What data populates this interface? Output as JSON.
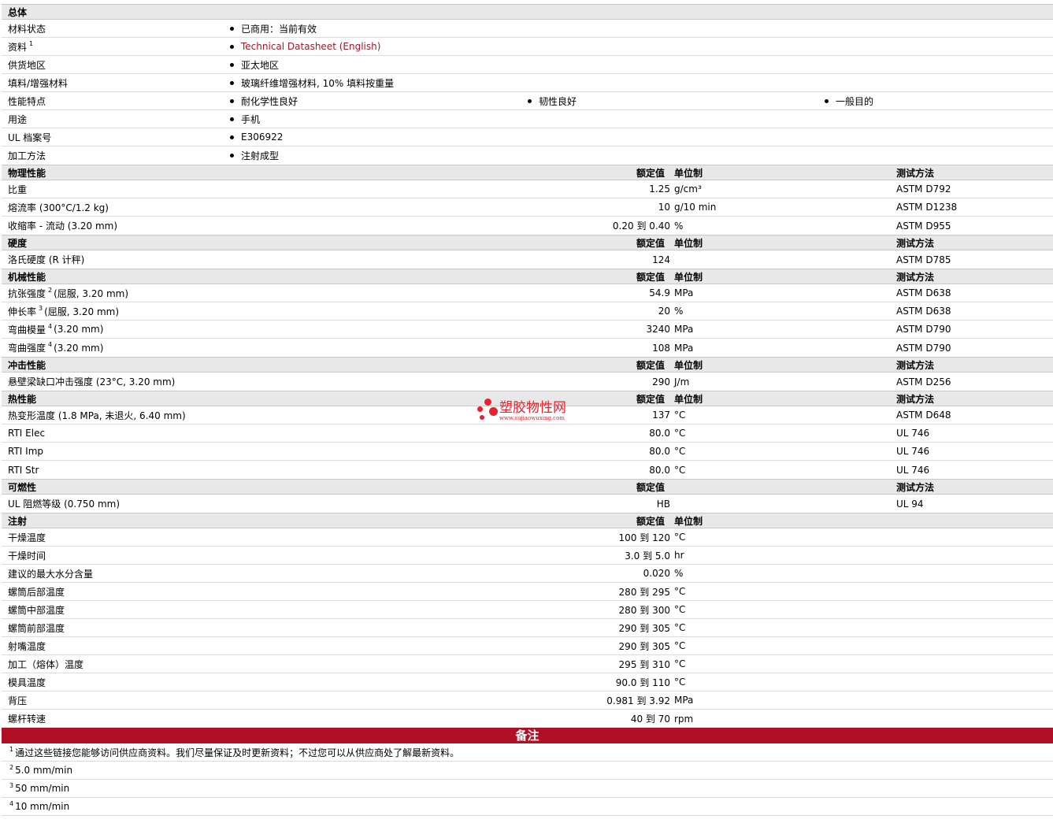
{
  "general": {
    "title": "总体",
    "material_status": {
      "label": "材料状态",
      "value": "已商用：当前有效"
    },
    "literature": {
      "label": "资料",
      "sup": "1",
      "value": "Technical Datasheet (English)"
    },
    "availability": {
      "label": "供货地区",
      "value": "亚太地区"
    },
    "filler": {
      "label": "填料/增强材料",
      "value": "玻璃纤维增强材料, 10% 填料按重量"
    },
    "features": {
      "label": "性能特点",
      "values": [
        "耐化学性良好",
        "韧性良好",
        "一般目的"
      ]
    },
    "uses": {
      "label": "用途",
      "value": "手机"
    },
    "ul_file": {
      "label": "UL 档案号",
      "value": "E306922"
    },
    "processing": {
      "label": "加工方法",
      "value": "注射成型"
    }
  },
  "headers": {
    "value": "额定值",
    "unit": "单位制",
    "method": "测试方法"
  },
  "physical": {
    "title": "物理性能",
    "rows": [
      {
        "label": "比重",
        "value": "1.25",
        "unit": "g/cm³",
        "method": "ASTM D792"
      },
      {
        "label": "熔流率  (300°C/1.2 kg)",
        "value": "10",
        "unit": "g/10 min",
        "method": "ASTM D1238"
      },
      {
        "label": "收缩率  - 流动  (3.20 mm)",
        "value": "0.20 到  0.40",
        "unit": "%",
        "method": "ASTM D955"
      }
    ]
  },
  "hardness": {
    "title": "硬度",
    "rows": [
      {
        "label": "洛氏硬度  (R 计秤)",
        "value": "124",
        "unit": "",
        "method": "ASTM D785"
      }
    ]
  },
  "mechanical": {
    "title": "机械性能",
    "rows": [
      {
        "label": "抗张强度",
        "sup": "2",
        "label2": "(屈服, 3.20 mm)",
        "value": "54.9",
        "unit": "MPa",
        "method": "ASTM D638"
      },
      {
        "label": "伸长率",
        "sup": "3",
        "label2": "(屈服, 3.20 mm)",
        "value": "20",
        "unit": "%",
        "method": "ASTM D638"
      },
      {
        "label": "弯曲模量",
        "sup": "4",
        "label2": "(3.20 mm)",
        "value": "3240",
        "unit": "MPa",
        "method": "ASTM D790"
      },
      {
        "label": "弯曲强度",
        "sup": "4",
        "label2": "(3.20 mm)",
        "value": "108",
        "unit": "MPa",
        "method": "ASTM D790"
      }
    ]
  },
  "impact": {
    "title": "冲击性能",
    "rows": [
      {
        "label": "悬壁梁缺口冲击强度  (23°C, 3.20 mm)",
        "value": "290",
        "unit": "J/m",
        "method": "ASTM D256"
      }
    ]
  },
  "thermal": {
    "title": "热性能",
    "rows": [
      {
        "label": "热变形温度  (1.8 MPa, 未退火, 6.40 mm)",
        "value": "137",
        "unit": "°C",
        "method": "ASTM D648"
      },
      {
        "label": "RTI Elec",
        "value": "80.0",
        "unit": "°C",
        "method": "UL 746"
      },
      {
        "label": "RTI Imp",
        "value": "80.0",
        "unit": "°C",
        "method": "UL 746"
      },
      {
        "label": "RTI Str",
        "value": "80.0",
        "unit": "°C",
        "method": "UL 746"
      }
    ]
  },
  "flammability": {
    "title": "可燃性",
    "rows": [
      {
        "label": "UL 阻燃等级  (0.750 mm)",
        "value": "HB",
        "unit": "",
        "method": "UL 94"
      }
    ]
  },
  "injection": {
    "title": "注射",
    "rows": [
      {
        "label": "干燥温度",
        "value": "100 到  120",
        "unit": "°C"
      },
      {
        "label": "干燥时间",
        "value": "3.0 到  5.0",
        "unit": "hr"
      },
      {
        "label": "建议的最大水分含量",
        "value": "0.020",
        "unit": "%"
      },
      {
        "label": "螺筒后部温度",
        "value": "280 到  295",
        "unit": "°C"
      },
      {
        "label": "螺筒中部温度",
        "value": "280 到  300",
        "unit": "°C"
      },
      {
        "label": "螺筒前部温度",
        "value": "290 到  305",
        "unit": "°C"
      },
      {
        "label": "射嘴温度",
        "value": "290 到  305",
        "unit": "°C"
      },
      {
        "label": "加工（熔体）温度",
        "value": "295 到  310",
        "unit": "°C"
      },
      {
        "label": "模具温度",
        "value": "90.0 到  110",
        "unit": "°C"
      },
      {
        "label": "背压",
        "value": "0.981 到  3.92",
        "unit": "MPa"
      },
      {
        "label": "螺杆转速",
        "value": "40 到  70",
        "unit": "rpm"
      }
    ]
  },
  "notes": {
    "title": "备注",
    "rows": [
      {
        "sup": "1",
        "text": "通过这些链接您能够访问供应商资料。我们尽量保证及时更新资料；不过您可以从供应商处了解最新资料。"
      },
      {
        "sup": "2",
        "text": "5.0 mm/min"
      },
      {
        "sup": "3",
        "text": "50 mm/min"
      },
      {
        "sup": "4",
        "text": "10 mm/min"
      }
    ]
  },
  "watermark": {
    "title": "塑胶物性网",
    "url": "www.sujiaowuxing.com"
  }
}
